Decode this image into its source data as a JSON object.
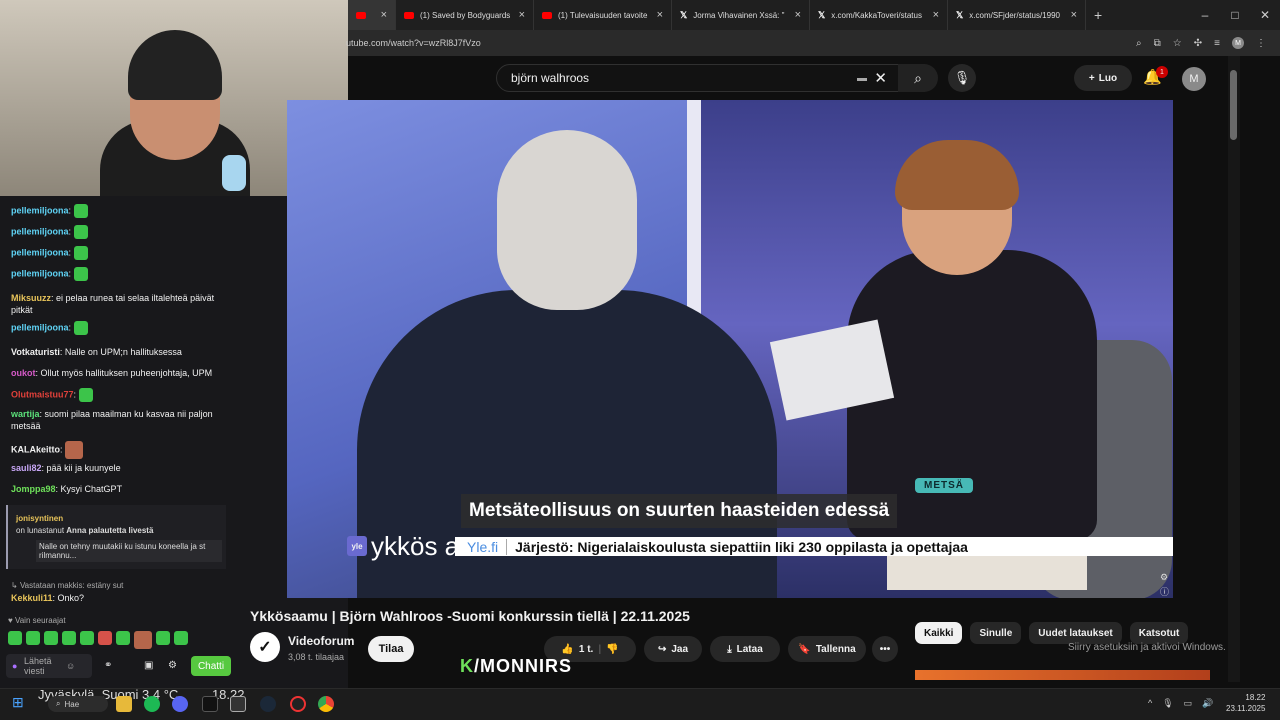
{
  "browser": {
    "tabs": [
      {
        "label": "",
        "active": true,
        "icon": "youtube-icon"
      },
      {
        "label": "(1) Saved by Bodyguards",
        "icon": "youtube-icon"
      },
      {
        "label": "(1) Tulevaisuuden tavoite",
        "icon": "youtube-icon"
      },
      {
        "label": "Jorma Vihavainen Xssä: \"",
        "icon": "x-icon"
      },
      {
        "label": "x.com/KakkaToveri/status",
        "icon": "x-icon"
      },
      {
        "label": "x.com/SFjder/status/1990",
        "icon": "x-icon"
      }
    ],
    "new_tab": "+",
    "url": "utube.com/watch?v=wzRl8J7fVzo",
    "profile": "M"
  },
  "youtube": {
    "search_value": "björn walhroos",
    "create_label": "Luo",
    "notification_count": "1",
    "account_initial": "M"
  },
  "video": {
    "tag": "METSÄ",
    "headline": "Metsäteollisuus on suurten haasteiden edessä",
    "logo_badge": "yle",
    "logo_name": "ykkös aamu",
    "ticker_source": "Yle.fi",
    "ticker_text": "Järjestö: Nigerialaiskoulusta siepattiin liki 230 oppilasta ja opettajaa"
  },
  "info": {
    "title": "Ykkösaamu | Björn Wahlroos -Suomi konkurssin tiellä | 22.11.2025",
    "channel": "Videoforum",
    "subscribers": "3,08 t. tilaajaa",
    "subscribe": "Tilaa",
    "likes": "1 t.",
    "share": "Jaa",
    "download": "Lataa",
    "save": "Tallenna"
  },
  "chips": [
    "Kaikki",
    "Sinulle",
    "Uudet lataukset",
    "Katsotut"
  ],
  "windows_watermark": "Siirry asetuksiin ja aktivoi Windows.",
  "stream_overlay": "/MONNIRS",
  "chat": {
    "messages": [
      {
        "user": "pellemiljoona",
        "color": "#5fd3f5",
        "text": ""
      },
      {
        "user": "pellemiljoona",
        "color": "#5fd3f5",
        "text": ""
      },
      {
        "user": "pellemiljoona",
        "color": "#5fd3f5",
        "text": ""
      },
      {
        "user": "pellemiljoona",
        "color": "#5fd3f5",
        "text": ""
      },
      {
        "user": "Miksuuzz",
        "color": "#e8c45a",
        "text": "ei pelaa runea tai selaa iltalehteä päivät pitkät"
      },
      {
        "user": "pellemiljoona",
        "color": "#5fd3f5",
        "text": ""
      },
      {
        "user": "Votkaturisti",
        "color": "#f0f0f0",
        "text": "Nalle on UPM;n hallituksessa"
      },
      {
        "user": "oukot",
        "color": "#d65ac8",
        "text": "Ollut myös hallituksen puheenjohtaja, UPM"
      },
      {
        "user": "Olutmaistuu77",
        "color": "#e0403a",
        "text": ""
      },
      {
        "user": "wartija",
        "color": "#5be07a",
        "text": "suomi pilaa maailman ku kasvaa nii paljon metsää"
      },
      {
        "user": "KALAkeitto",
        "color": "#f0f0f0",
        "text": ""
      },
      {
        "user": "sauli82",
        "color": "#c7a6f5",
        "text": "pää kii ja kuunyele"
      },
      {
        "user": "Jomppa98",
        "color": "#6ee05a",
        "text": "Kysyi ChatGPT"
      }
    ],
    "redeem_user": "jonisyntinen",
    "redeem_prefix": "on lunastanut",
    "redeem_reward": "Anna palautetta livestä",
    "redeem_quote": "Nalle on tehny muutakii ku istunu koneella ja st rilmannu...",
    "reply_context": "Vastataan makkis: estäny sut",
    "last_user": "Kekkuli11",
    "last_text": "Onko?",
    "followers_only": "Vain seuraajat",
    "input_placeholder": "Lähetä viesti",
    "chat_button": "Chatti"
  },
  "taskbar": {
    "weather": "Jyväskylä, Suomi   3,4 °C",
    "time_overlap": "18.22",
    "search": "Hae",
    "time": "18.22",
    "date": "23.11.2025"
  }
}
